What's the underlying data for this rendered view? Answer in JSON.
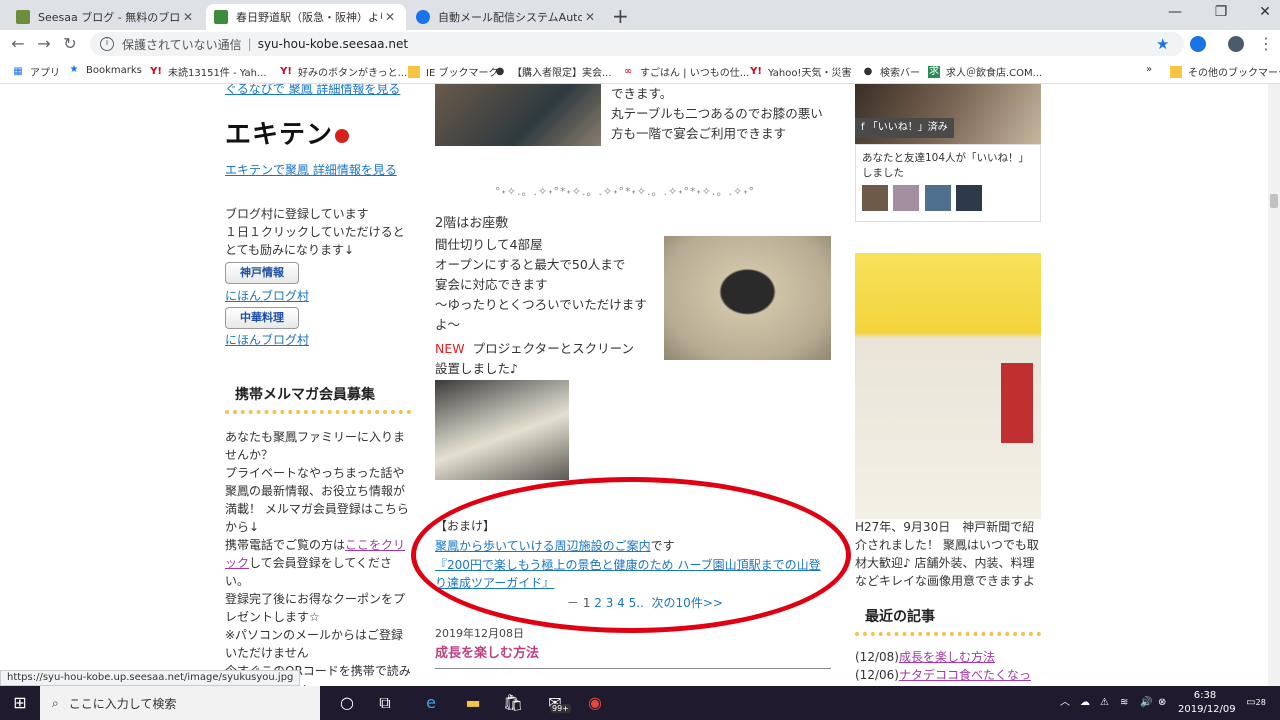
{
  "browser": {
    "tabs": [
      {
        "title": "Seesaa ブログ - 無料のブログ(blog)サ",
        "active": false
      },
      {
        "title": "春日野道駅（阪急・阪神）より徒歩",
        "active": true
      },
      {
        "title": "自動メール配信システムAutoBiz Ver",
        "active": false
      }
    ],
    "new_tab": "+",
    "security_label": "保護されていない通信",
    "url": "syu-hou-kobe.seesaa.net",
    "bookmarks": [
      {
        "label": "アプリ",
        "icon": "apps-grid-icon"
      },
      {
        "label": "Bookmarks",
        "icon": "star-icon"
      },
      {
        "label": "未読13151件 - Yah...",
        "icon": "yahoo-icon"
      },
      {
        "label": "好みのボタンがきっと...",
        "icon": "yahoo-icon"
      },
      {
        "label": "IE ブックマーク",
        "icon": "folder-icon"
      },
      {
        "label": "【購入者限定】実会...",
        "icon": "globe-icon"
      },
      {
        "label": "すごはん | いつもの仕...",
        "icon": "site-icon"
      },
      {
        "label": "Yahoo!天気・災害",
        "icon": "yahoo-icon"
      },
      {
        "label": "検索バー",
        "icon": "globe-icon"
      },
      {
        "label": "求人＠飲食店.COM...",
        "icon": "site-icon"
      }
    ],
    "bookmarks_more": "»",
    "other_bookmarks": "その他のブックマーク",
    "status_url": "https://syu-hou-kobe.up.seesaa.net/image/syukusyou.jpg"
  },
  "left_sidebar": {
    "gurunavi_link": "ぐるなびで 聚鳳 詳細情報を見る",
    "ekiten_logo": "エキテン",
    "ekiten_link": "エキテンで聚鳳 詳細情報を見る",
    "blogmura_text": "ブログ村に登録しています\n１日１クリックしていただけると\nとても励みになります↓",
    "badge1": "神戸情報",
    "badge1_link": "にほんブログ村",
    "badge2": "中華料理",
    "badge2_link": "にほんブログ村",
    "mail_title": "携帯メルマガ会員募集",
    "mail_p1": "あなたも聚鳳ファミリーに入りませんか？",
    "mail_p2": "プライベートなやっちまった話や 聚鳳の最新情報、お役立ち情報が満載！ メルマガ会員登録はこちらから↓",
    "mail_p3a": "携帯電話でご覧の方は",
    "mail_p3_link": "ここをクリック",
    "mail_p3b": "して会員登録をしてください。",
    "mail_p4": "登録完了後にお得なクーポンをプレゼントします☆",
    "mail_p5": "※パソコンのメールからはご登録いただけません",
    "mail_p6": "今すぐこのQRコードを携帯で読み取ってください"
  },
  "main": {
    "intro_lines": [
      "できます。",
      "丸テーブルも二つあるのでお膝の悪い",
      "方も一階で宴会ご利用できます"
    ],
    "ornament": "°˖✧.。.✧˖°*˖✧.。.✧˖°*˖✧.。.✧˖°*˖✧.。.✧˖°",
    "floor2_title": "2階はお座敷",
    "floor2_lines": [
      "間仕切りして4部屋",
      "オープンにすると最大で50人まで",
      "宴会に対応できます",
      "〜ゆったりとくつろいでいただけますよ〜"
    ],
    "new_label": "NEW",
    "new_text": "プロジェクターとスクリーン",
    "new_text2": "設置しました♪",
    "omake_label": "【おまけ】",
    "omake_link1": "聚鳳から歩いていける周辺施設のご案内",
    "omake_link1_suffix": "です",
    "omake_link2": "『200円で楽しもう極上の景色と健康のため ハーブ園山頂駅までの山登り達成ツアーガイド』",
    "pager_prefix": "－ 1",
    "pager_pages": "2 3 4 5..",
    "pager_next": "次の10件>>",
    "post_date": "2019年12月08日",
    "post_title": "成長を楽しむ方法"
  },
  "right_sidebar": {
    "fb_liked": "「いいね！」済み",
    "fb_text": "あなたと友達104人が「いいね！」しました",
    "newspaper_caption": "H27年、9月30日　神戸新聞で紹介されました！ 聚鳳はいつでも取材大歓迎♪ 店舗外装、内装、料理などキレイな画像用意できますよ",
    "recent_title": "最近の記事",
    "recent_posts": [
      {
        "date": "(12/08)",
        "title": "成長を楽しむ方法"
      },
      {
        "date": "(12/06)",
        "title": "ナタデココ食べたくなった"
      }
    ]
  },
  "taskbar": {
    "search_placeholder": "ここに入力して検索",
    "store_badge": "99+",
    "time": "6:38",
    "date": "2019/12/09",
    "notification_count": "28"
  }
}
